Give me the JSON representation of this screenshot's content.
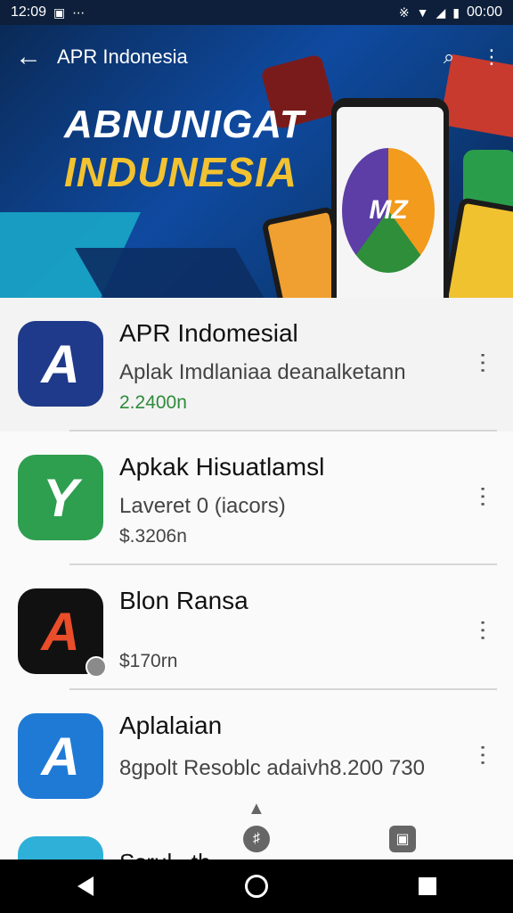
{
  "status_bar": {
    "time_left": "12:09",
    "notif": "⋯",
    "time_right": "00:00"
  },
  "app_bar": {
    "title": "APR Indonesia",
    "back_icon": "←",
    "search_icon": "⌕",
    "more_icon": "⋮"
  },
  "banner": {
    "line1": "ABNUNIGAT",
    "line2": "INDUNESIA",
    "phone_logo": "MZ"
  },
  "apps": [
    {
      "name": "APR Indomesial",
      "subtitle": "Aplak Imdlaniaa deanalketann",
      "price": "2.2400n",
      "price_color": "#2e8b3a",
      "icon_letter": "A",
      "icon_color": "#1f3a8a"
    },
    {
      "name": "Apkak Hisuatlamsl",
      "subtitle": "Laveret 0 (iacors)",
      "price": "$.3206n",
      "icon_letter": "Y",
      "icon_color": "#2e9e4f"
    },
    {
      "name": "Blon Ransa",
      "subtitle": "",
      "price": "$170rn",
      "icon_letter": "A",
      "icon_color": "#111111"
    },
    {
      "name": "Aplalaian",
      "subtitle": "8gpolt Resoblc adaivh8.200 730",
      "price": "",
      "icon_letter": "A",
      "icon_color": "#1f7ad6"
    }
  ],
  "partial_item": {
    "text": "Ssrul...th"
  },
  "nav": {
    "back": "back",
    "home": "home",
    "recents": "recents"
  }
}
